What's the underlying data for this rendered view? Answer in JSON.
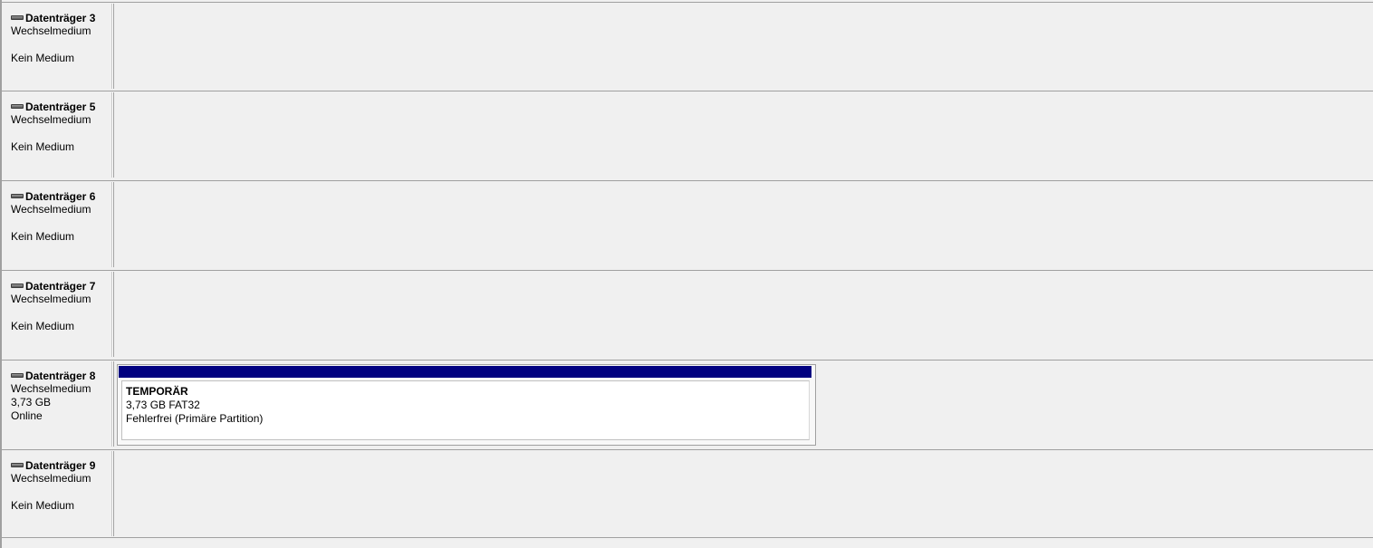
{
  "disks": [
    {
      "name": "Datenträger 3",
      "type": "Wechselmedium",
      "size": "",
      "status": "Kein Medium"
    },
    {
      "name": "Datenträger 5",
      "type": "Wechselmedium",
      "size": "",
      "status": "Kein Medium"
    },
    {
      "name": "Datenträger 6",
      "type": "Wechselmedium",
      "size": "",
      "status": "Kein Medium"
    },
    {
      "name": "Datenträger 7",
      "type": "Wechselmedium",
      "size": "",
      "status": "Kein Medium"
    },
    {
      "name": "Datenträger 8",
      "type": "Wechselmedium",
      "size": "3,73 GB",
      "status": "Online",
      "partition": {
        "label": "TEMPORÄR",
        "size_fs": "3,73 GB FAT32",
        "health": "Fehlerfrei (Primäre Partition)"
      }
    },
    {
      "name": "Datenträger 9",
      "type": "Wechselmedium",
      "size": "",
      "status": "Kein Medium"
    }
  ],
  "colors": {
    "partition_bar": "#000080",
    "background": "#f0f0f0"
  },
  "icons": {
    "disk": "removable-disk-icon"
  }
}
